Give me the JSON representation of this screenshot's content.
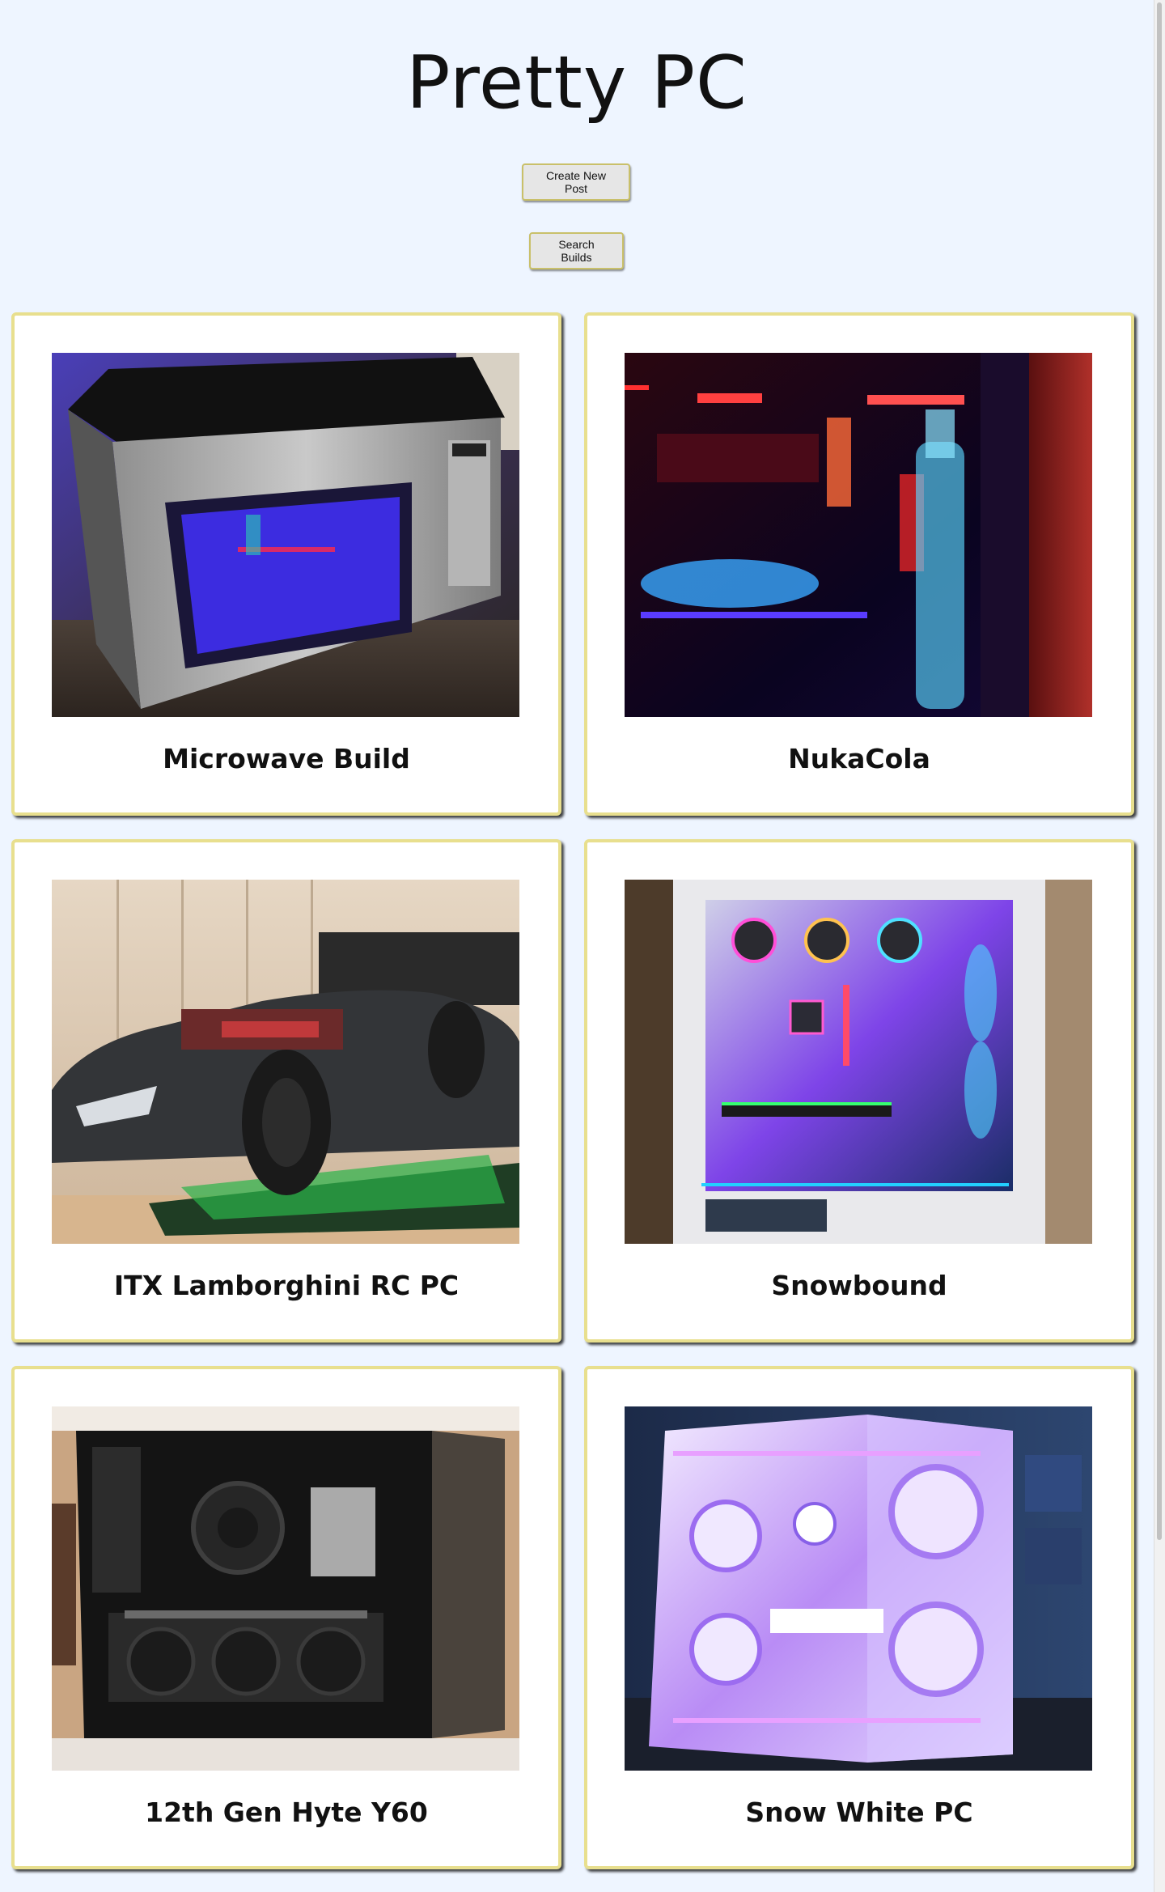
{
  "header": {
    "title": "Pretty PC"
  },
  "actions": {
    "create_label": "Create New Post",
    "search_label": "Search Builds"
  },
  "builds": [
    {
      "title": "Microwave Build"
    },
    {
      "title": "NukaCola"
    },
    {
      "title": "ITX Lamborghini RC PC"
    },
    {
      "title": "Snowbound"
    },
    {
      "title": "12th Gen Hyte Y60"
    },
    {
      "title": "Snow White PC"
    }
  ],
  "colors": {
    "page_background": "#eef5ff",
    "card_border": "#e8df8e",
    "button_background": "#e6e6e6"
  }
}
